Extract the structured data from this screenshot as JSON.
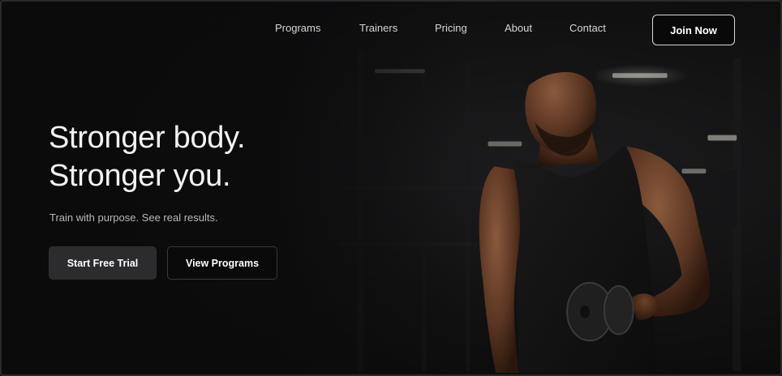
{
  "nav": {
    "links": [
      {
        "label": "Programs"
      },
      {
        "label": "Trainers"
      },
      {
        "label": "Pricing"
      },
      {
        "label": "About"
      },
      {
        "label": "Contact"
      }
    ],
    "cta_label": "Join Now"
  },
  "hero": {
    "title_line1": "Stronger body.",
    "title_line2": "Stronger you.",
    "subtitle": "Train with purpose. See real results.",
    "primary_button": "Start Free Trial",
    "secondary_button": "View Programs",
    "image": "athlete-with-dumbbell-photo"
  },
  "colors": {
    "background": "#0b0b0c",
    "text_primary": "#f2f2f2",
    "text_muted": "#b8b8b8",
    "button_primary_bg": "#2c2c2e"
  }
}
